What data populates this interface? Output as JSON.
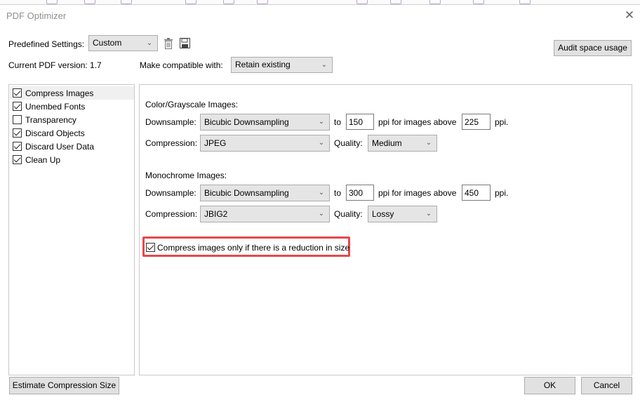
{
  "window": {
    "title": "PDF Optimizer"
  },
  "top": {
    "predefined_label": "Predefined Settings:",
    "predefined_value": "Custom",
    "audit_button": "Audit space usage",
    "version_label": "Current PDF version: 1.7",
    "compat_label": "Make compatible with:",
    "compat_value": "Retain existing"
  },
  "sidebar": {
    "items": [
      {
        "label": "Compress Images",
        "checked": true
      },
      {
        "label": "Unembed Fonts",
        "checked": true
      },
      {
        "label": "Transparency",
        "checked": false
      },
      {
        "label": "Discard Objects",
        "checked": true
      },
      {
        "label": "Discard User Data",
        "checked": true
      },
      {
        "label": "Clean Up",
        "checked": true
      }
    ]
  },
  "color_section": {
    "heading": "Color/Grayscale Images:",
    "downsample_label": "Downsample:",
    "downsample_value": "Bicubic Downsampling",
    "to_label": "to",
    "target_ppi": "150",
    "ppi_label": "ppi  for images above",
    "above_ppi": "225",
    "ppi_suffix": "ppi.",
    "compression_label": "Compression:",
    "compression_value": "JPEG",
    "quality_label": "Quality:",
    "quality_value": "Medium"
  },
  "mono_section": {
    "heading": "Monochrome Images:",
    "downsample_label": "Downsample:",
    "downsample_value": "Bicubic Downsampling",
    "to_label": "to",
    "target_ppi": "300",
    "ppi_label": "ppi  for images above",
    "above_ppi": "450",
    "ppi_suffix": "ppi.",
    "compression_label": "Compression:",
    "compression_value": "JBIG2",
    "quality_label": "Quality:",
    "quality_value": "Lossy"
  },
  "compress_only": {
    "label": "Compress images only if there is a reduction in size",
    "checked": true
  },
  "footer": {
    "estimate_button": "Estimate Compression Size",
    "ok_button": "OK",
    "cancel_button": "Cancel"
  },
  "colors": {
    "highlight": "#e8474b",
    "button_bg": "#e1e1e1",
    "border": "#adadad"
  }
}
